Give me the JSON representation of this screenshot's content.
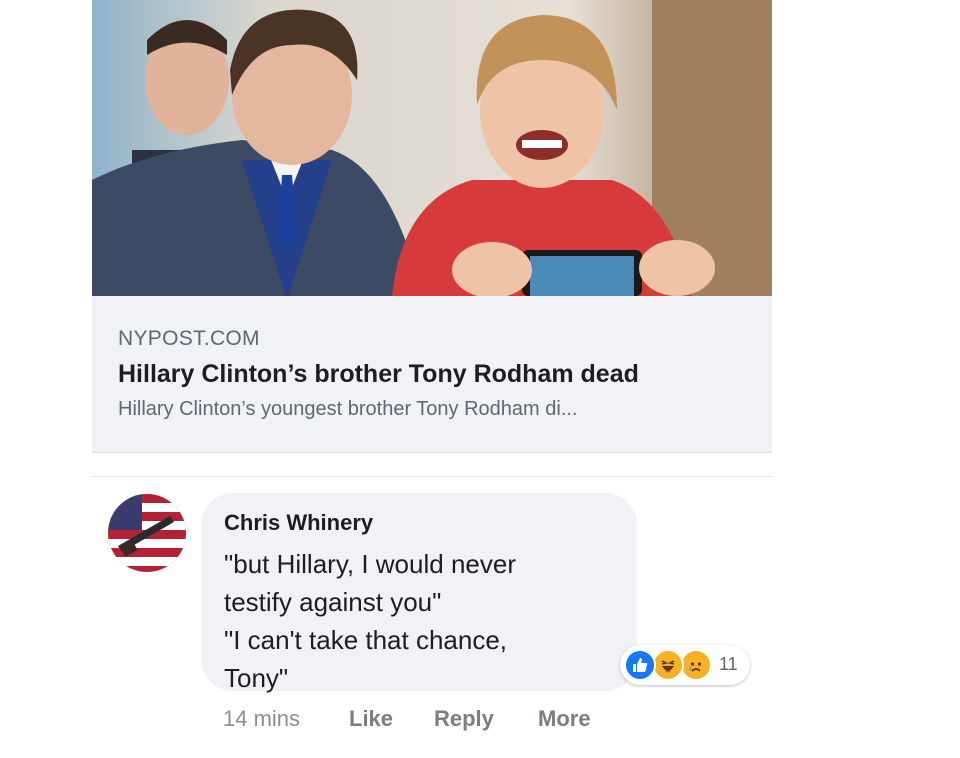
{
  "link_preview": {
    "domain": "NYPOST.COM",
    "title": "Hillary Clinton’s brother Tony Rodham dead",
    "description": "Hillary Clinton’s youngest brother Tony Rodham di..."
  },
  "comment": {
    "author": "Chris Whinery",
    "lines": [
      "\"but Hillary, I would never",
      "testify against you\"",
      "\"I can't take that chance,",
      "Tony\""
    ],
    "reactions": {
      "icons": [
        "like-icon",
        "haha-icon",
        "sad-icon"
      ],
      "count": "11"
    },
    "timestamp": "14 mins",
    "actions": {
      "like": "Like",
      "reply": "Reply",
      "more": "More"
    }
  },
  "colors": {
    "link_box_bg": "#f1f2f5",
    "bubble_bg": "#f0f2f5",
    "like_blue": "#1877f2",
    "emoji_yellow": "#f7b125",
    "meta_gray": "#8a8d91"
  }
}
